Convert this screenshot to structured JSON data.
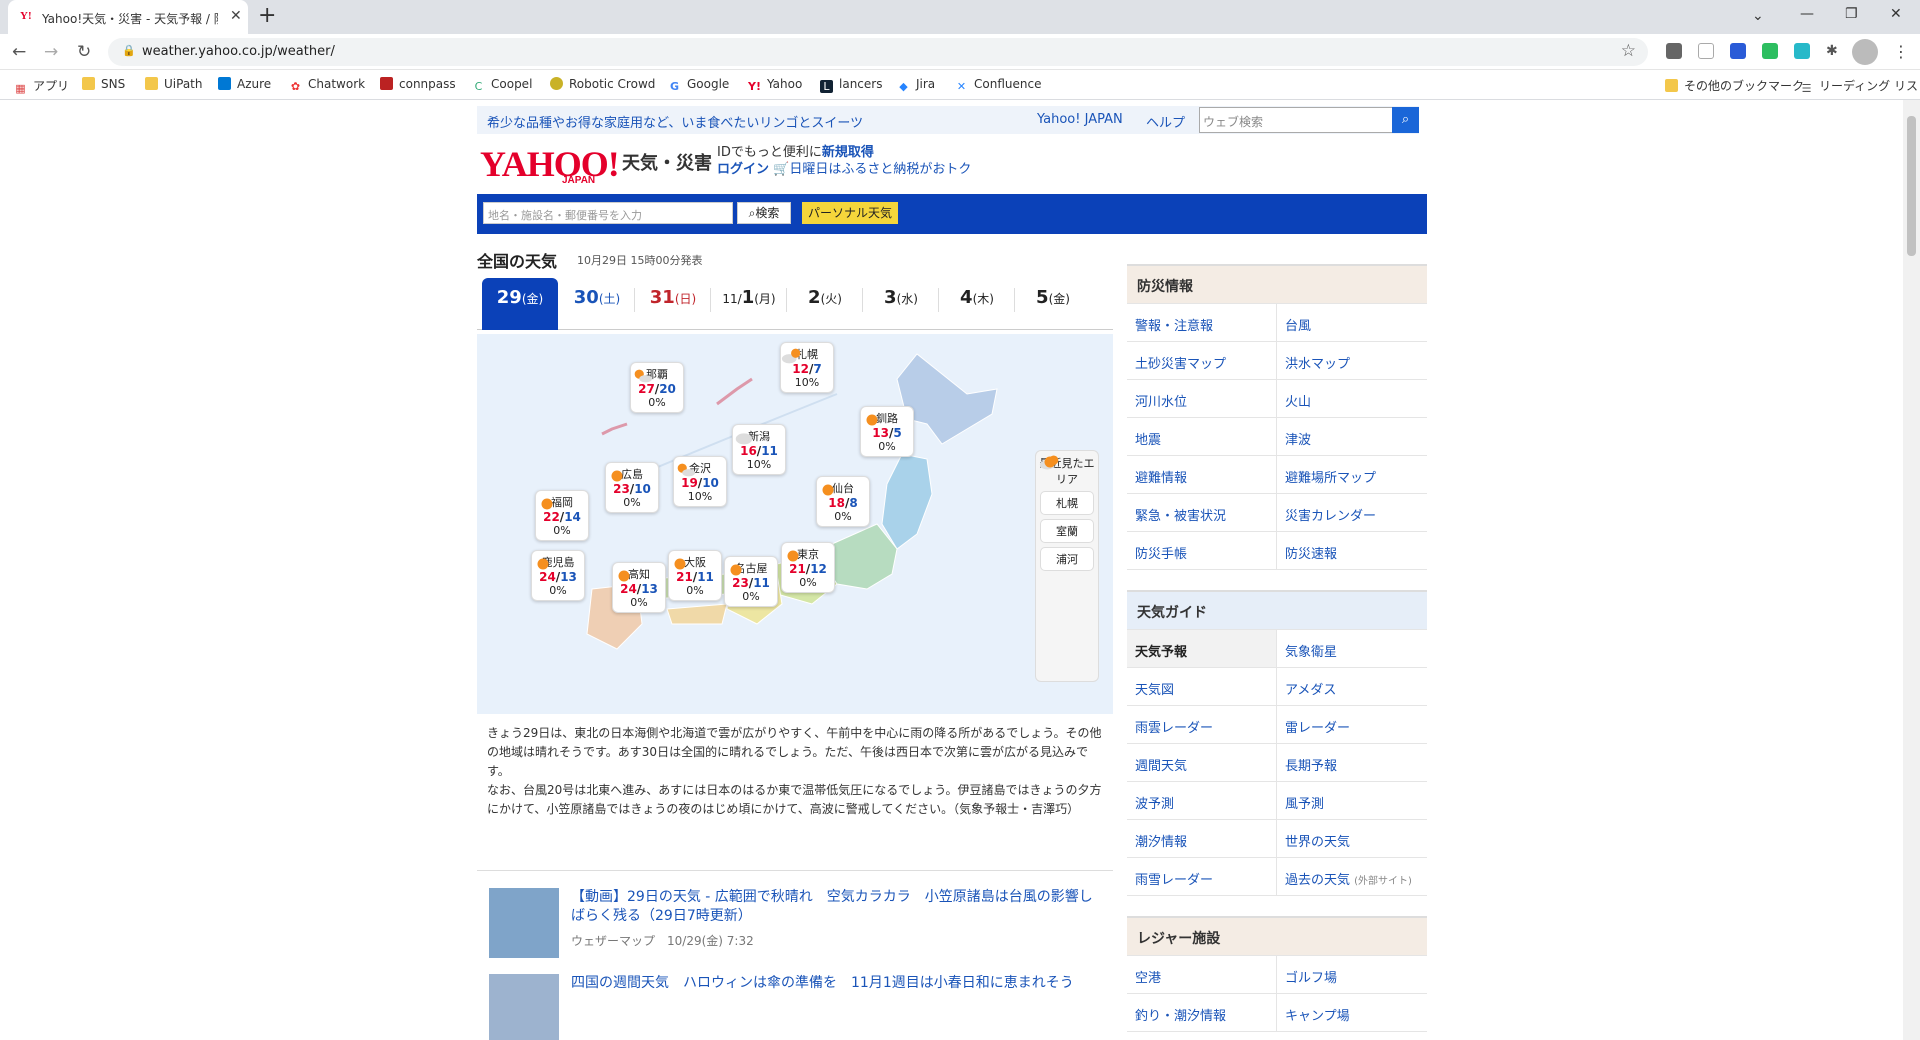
{
  "browser": {
    "tab_title": "Yahoo!天気・災害 - 天気予報 / 防",
    "tab_favicon": "Y!",
    "url": "weather.yahoo.co.jp/weather/",
    "bookmarks": [
      "アプリ",
      "SNS",
      "UiPath",
      "Azure",
      "Chatwork",
      "connpass",
      "Coopel",
      "Robotic Crowd",
      "Google",
      "Yahoo",
      "lancers",
      "Jira",
      "Confluence"
    ],
    "other_bookmarks": "その他のブックマーク",
    "reading_list": "リーディング リスト"
  },
  "header": {
    "promo": "希少な品種やお得な家庭用など、いま食べたいリンゴとスイーツ",
    "yahoo_japan": "Yahoo! JAPAN",
    "help": "ヘルプ",
    "web_search_placeholder": "ウェブ検索",
    "logo_text": "YAHOO!",
    "logo_sub": "JAPAN",
    "service": "天気・災害",
    "id_prefix": "IDでもっと便利に",
    "signup": "新規取得",
    "login": "ログイン",
    "furusato": "日曜日はふるさと納税がおトク",
    "location_placeholder": "地名・施設名・郵便番号を入力",
    "search_btn": "検索",
    "personal_btn": "パーソナル天気"
  },
  "main": {
    "title": "全国の天気",
    "issued": "10月29日 15時00分発表",
    "days": [
      {
        "d": "29",
        "w": "(金)",
        "prefix": ""
      },
      {
        "d": "30",
        "w": "(土)",
        "prefix": ""
      },
      {
        "d": "31",
        "w": "(日)",
        "prefix": ""
      },
      {
        "d": "1",
        "w": "(月)",
        "prefix": "11/"
      },
      {
        "d": "2",
        "w": "(火)",
        "prefix": ""
      },
      {
        "d": "3",
        "w": "(水)",
        "prefix": ""
      },
      {
        "d": "4",
        "w": "(木)",
        "prefix": ""
      },
      {
        "d": "5",
        "w": "(金)",
        "prefix": ""
      }
    ],
    "cities": [
      {
        "name": "那覇",
        "hi": "27",
        "lo": "20",
        "pop": "0%",
        "icon": "sun-cloud-icon"
      },
      {
        "name": "札幌",
        "hi": "12",
        "lo": "7",
        "pop": "10%",
        "icon": "cloud-sun-icon"
      },
      {
        "name": "新潟",
        "hi": "16",
        "lo": "11",
        "pop": "10%",
        "icon": "cloud-icon"
      },
      {
        "name": "釧路",
        "hi": "13",
        "lo": "5",
        "pop": "0%",
        "icon": "sun-icon"
      },
      {
        "name": "広島",
        "hi": "23",
        "lo": "10",
        "pop": "0%",
        "icon": "sun-icon"
      },
      {
        "name": "金沢",
        "hi": "19",
        "lo": "10",
        "pop": "10%",
        "icon": "sun-cloud-icon"
      },
      {
        "name": "仙台",
        "hi": "18",
        "lo": "8",
        "pop": "0%",
        "icon": "sun-icon"
      },
      {
        "name": "福岡",
        "hi": "22",
        "lo": "14",
        "pop": "0%",
        "icon": "sun-icon"
      },
      {
        "name": "鹿児島",
        "hi": "24",
        "lo": "13",
        "pop": "0%",
        "icon": "sun-icon"
      },
      {
        "name": "高知",
        "hi": "24",
        "lo": "13",
        "pop": "0%",
        "icon": "sun-icon"
      },
      {
        "name": "大阪",
        "hi": "21",
        "lo": "11",
        "pop": "0%",
        "icon": "sun-icon"
      },
      {
        "name": "名古屋",
        "hi": "23",
        "lo": "11",
        "pop": "0%",
        "icon": "sun-icon"
      },
      {
        "name": "東京",
        "hi": "21",
        "lo": "12",
        "pop": "0%",
        "icon": "sun-icon"
      }
    ],
    "recent_title": "最近見たエリア",
    "recent": [
      {
        "name": "札幌",
        "icon": "cloud-sun-icon"
      },
      {
        "name": "室蘭",
        "icon": "cloud-sun-icon"
      },
      {
        "name": "浦河",
        "icon": "sun-icon"
      }
    ],
    "description": "きょう29日は、東北の日本海側や北海道で雲が広がりやすく、午前中を中心に雨の降る所があるでしょう。その他の地域は晴れそうです。あす30日は全国的に晴れるでしょう。ただ、午後は西日本で次第に雲が広がる見込みです。",
    "description2": "なお、台風20号は北東へ進み、あすには日本のはるか東で温帯低気圧になるでしょう。伊豆諸島ではきょうの夕方にかけて、小笠原諸島ではきょうの夜のはじめ頃にかけて、高波に警戒してください。（気象予報士・吉澤巧）",
    "news": [
      {
        "title": "【動画】29日の天気 - 広範囲で秋晴れ　空気カラカラ　小笠原諸島は台風の影響しばらく残る（29日7時更新）",
        "meta": "ウェザーマップ　10/29(金) 7:32"
      },
      {
        "title": "四国の週間天気　ハロウィンは傘の準備を　11月1週目は小春日和に恵まれそう",
        "meta": ""
      }
    ]
  },
  "side": {
    "bousai": {
      "title": "防災情報",
      "items": [
        "警報・注意報",
        "台風",
        "土砂災害マップ",
        "洪水マップ",
        "河川水位",
        "火山",
        "地震",
        "津波",
        "避難情報",
        "避難場所マップ",
        "緊急・被害状況",
        "災害カレンダー",
        "防災手帳",
        "防災速報"
      ]
    },
    "guide": {
      "title": "天気ガイド",
      "items": [
        "天気予報",
        "気象衛星",
        "天気図",
        "アメダス",
        "雨雲レーダー",
        "雷レーダー",
        "週間天気",
        "長期予報",
        "波予測",
        "風予測",
        "潮汐情報",
        "世界の天気",
        "雨雪レーダー",
        "過去の天気"
      ],
      "external": "(外部サイト)"
    },
    "leisure": {
      "title": "レジャー施設",
      "items": [
        "空港",
        "ゴルフ場",
        "釣り・潮汐情報",
        "キャンプ場"
      ]
    }
  },
  "colors": {
    "brand_red": "#e4002b",
    "yahoo_blue": "#0b41b8",
    "link": "#1a54b8"
  }
}
